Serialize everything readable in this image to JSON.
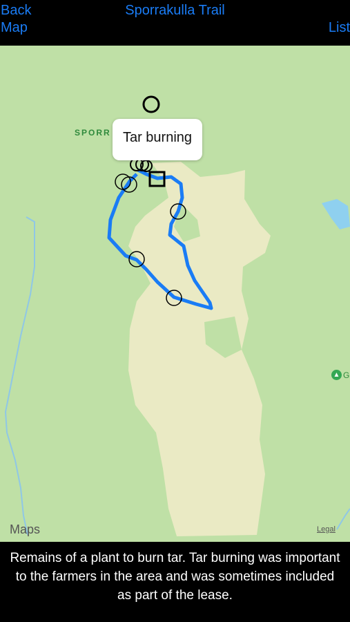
{
  "nav": {
    "back_label": "Back",
    "map_label": "Map",
    "title": "Sporrakulla Trail",
    "list_label": "List"
  },
  "map": {
    "callout_text": "Tar burning",
    "area_label": "SPORR",
    "poi_label": "G",
    "attribution": "Maps",
    "legal_label": "Legal",
    "colors": {
      "land": "#bfe0a6",
      "field": "#eaeac4",
      "water": "#8fd0ef",
      "route": "#1a7cf5"
    }
  },
  "description": {
    "text": "Remains of a plant to burn tar. Tar burning was important to the farmers in the area and was sometimes included as part of the lease."
  }
}
